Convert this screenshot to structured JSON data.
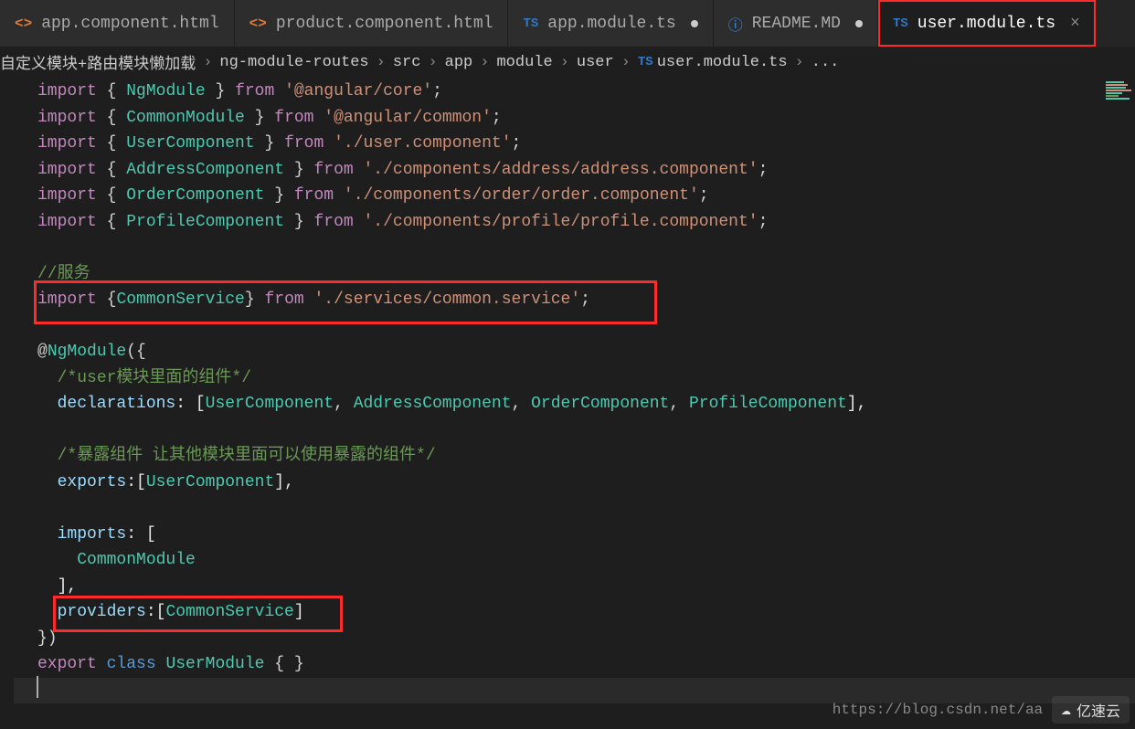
{
  "tabs": [
    {
      "icon": "html",
      "label": "app.component.html",
      "active": false,
      "dirty": false
    },
    {
      "icon": "html",
      "label": "product.component.html",
      "active": false,
      "dirty": false
    },
    {
      "icon": "ts",
      "label": "app.module.ts",
      "active": false,
      "dirty": true
    },
    {
      "icon": "info",
      "label": "README.MD",
      "active": false,
      "dirty": true
    },
    {
      "icon": "ts",
      "label": "user.module.ts",
      "active": true,
      "dirty": false,
      "outlined": true
    }
  ],
  "breadcrumbs": {
    "parts": [
      "自定义模块+路由模块懒加载",
      "ng-module-routes",
      "src",
      "app",
      "module",
      "user",
      "user.module.ts",
      "..."
    ],
    "file_icon": "ts"
  },
  "code": {
    "l1": {
      "a": "import ",
      "b": "{ ",
      "c": "NgModule",
      "d": " } ",
      "e": "from ",
      "f": "'@angular/core'",
      "g": ";"
    },
    "l2": {
      "a": "import ",
      "b": "{ ",
      "c": "CommonModule",
      "d": " } ",
      "e": "from ",
      "f": "'@angular/common'",
      "g": ";"
    },
    "l3": {
      "a": "import ",
      "b": "{ ",
      "c": "UserComponent",
      "d": " } ",
      "e": "from ",
      "f": "'./user.component'",
      "g": ";"
    },
    "l4": {
      "a": "import ",
      "b": "{ ",
      "c": "AddressComponent",
      "d": " } ",
      "e": "from ",
      "f": "'./components/address/address.component'",
      "g": ";"
    },
    "l5": {
      "a": "import ",
      "b": "{ ",
      "c": "OrderComponent",
      "d": " } ",
      "e": "from ",
      "f": "'./components/order/order.component'",
      "g": ";"
    },
    "l6": {
      "a": "import ",
      "b": "{ ",
      "c": "ProfileComponent",
      "d": " } ",
      "e": "from ",
      "f": "'./components/profile/profile.component'",
      "g": ";"
    },
    "l8": {
      "a": "//服务"
    },
    "l9": {
      "a": "import ",
      "b": "{",
      "c": "CommonService",
      "d": "} ",
      "e": "from ",
      "f": "'./services/common.service'",
      "g": ";"
    },
    "l11": {
      "a": "@",
      "b": "NgModule",
      "c": "({"
    },
    "l12": {
      "a": "  ",
      "b": "/*user模块里面的组件*/"
    },
    "l13": {
      "a": "  declarations",
      "b": ": [",
      "c": "UserComponent",
      "d": ", ",
      "e": "AddressComponent",
      "f": ", ",
      "g": "OrderComponent",
      "h": ", ",
      "i": "ProfileComponent",
      "j": "],"
    },
    "l15": {
      "a": "  ",
      "b": "/*暴露组件 让其他模块里面可以使用暴露的组件*/"
    },
    "l16": {
      "a": "  exports",
      "b": ":[",
      "c": "UserComponent",
      "d": "],"
    },
    "l18": {
      "a": "  imports",
      "b": ": ["
    },
    "l19": {
      "a": "    ",
      "b": "CommonModule"
    },
    "l20": {
      "a": "  ],"
    },
    "l21": {
      "a": "  providers",
      "b": ":[",
      "c": "CommonService",
      "d": "]"
    },
    "l22": {
      "a": "})"
    },
    "l23": {
      "a": "export ",
      "b": "class ",
      "c": "UserModule",
      "d": " { }"
    }
  },
  "footer": {
    "url": "https://blog.csdn.net/aa",
    "watermark_text": "亿速云"
  },
  "colors": {
    "highlight": "#ff2a2a",
    "keyword": "#c586c0",
    "type": "#4ec9b0",
    "string": "#ce9178",
    "comment": "#6a9955",
    "property": "#9cdcfe"
  }
}
